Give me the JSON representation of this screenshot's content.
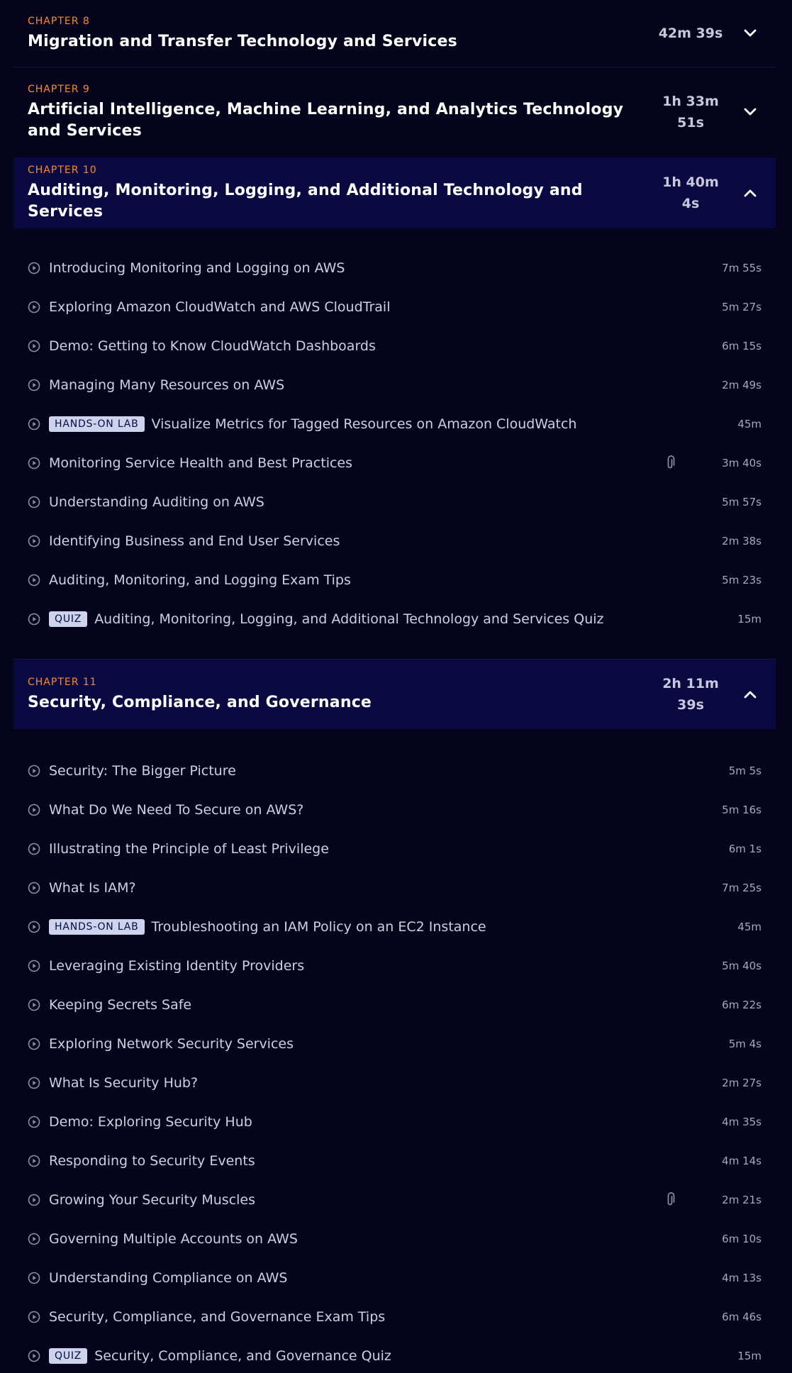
{
  "chapters": [
    {
      "label": "CHAPTER 8",
      "title": "Migration and Transfer Technology and Services",
      "duration": "42m 39s",
      "state": "collapsed",
      "toggle_icon": "chevron-down-icon"
    },
    {
      "label": "CHAPTER 9",
      "title": "Artificial Intelligence, Machine Learning, and Analytics Technology and Services",
      "duration": "1h 33m 51s",
      "state": "collapsed",
      "toggle_icon": "chevron-down-icon"
    },
    {
      "label": "CHAPTER 10",
      "title": "Auditing, Monitoring, Logging, and Additional Technology and Services",
      "duration": "1h 40m 4s",
      "state": "expanded",
      "toggle_icon": "chevron-up-icon",
      "lessons": [
        {
          "title": "Introducing Monitoring and Logging on AWS",
          "time": "7m 55s"
        },
        {
          "title": "Exploring Amazon CloudWatch and AWS CloudTrail",
          "time": "5m 27s"
        },
        {
          "title": "Demo: Getting to Know CloudWatch Dashboards",
          "time": "6m 15s"
        },
        {
          "title": "Managing Many Resources on AWS",
          "time": "2m 49s"
        },
        {
          "title": "Visualize Metrics for Tagged Resources on Amazon CloudWatch",
          "time": "45m",
          "badge": "HANDS-ON LAB"
        },
        {
          "title": "Monitoring Service Health and Best Practices",
          "time": "3m 40s",
          "attachment": true
        },
        {
          "title": "Understanding Auditing on AWS",
          "time": "5m 57s"
        },
        {
          "title": "Identifying Business and End User Services",
          "time": "2m 38s"
        },
        {
          "title": "Auditing, Monitoring, and Logging Exam Tips",
          "time": "5m 23s"
        },
        {
          "title": "Auditing, Monitoring, Logging, and Additional Technology and Services Quiz",
          "time": "15m",
          "badge": "QUIZ"
        }
      ]
    },
    {
      "label": "CHAPTER 11",
      "title": "Security, Compliance, and Governance",
      "duration": "2h 11m 39s",
      "state": "expanded",
      "toggle_icon": "chevron-up-icon",
      "lessons": [
        {
          "title": "Security: The Bigger Picture",
          "time": "5m 5s"
        },
        {
          "title": "What Do We Need To Secure on AWS?",
          "time": "5m 16s"
        },
        {
          "title": "Illustrating the Principle of Least Privilege",
          "time": "6m 1s"
        },
        {
          "title": "What Is IAM?",
          "time": "7m 25s"
        },
        {
          "title": "Troubleshooting an IAM Policy on an EC2 Instance",
          "time": "45m",
          "badge": "HANDS-ON LAB"
        },
        {
          "title": "Leveraging Existing Identity Providers",
          "time": "5m 40s"
        },
        {
          "title": "Keeping Secrets Safe",
          "time": "6m 22s"
        },
        {
          "title": "Exploring Network Security Services",
          "time": "5m 4s"
        },
        {
          "title": "What Is Security Hub?",
          "time": "2m 27s"
        },
        {
          "title": "Demo: Exploring Security Hub",
          "time": "4m 35s"
        },
        {
          "title": "Responding to Security Events",
          "time": "4m 14s"
        },
        {
          "title": "Growing Your Security Muscles",
          "time": "2m 21s",
          "attachment": true
        },
        {
          "title": "Governing Multiple Accounts on AWS",
          "time": "6m 10s"
        },
        {
          "title": "Understanding Compliance on AWS",
          "time": "4m 13s"
        },
        {
          "title": "Security, Compliance, and Governance Exam Tips",
          "time": "6m 46s"
        },
        {
          "title": "Security, Compliance, and Governance Quiz",
          "time": "15m",
          "badge": "QUIZ"
        }
      ]
    }
  ],
  "colors": {
    "background": "#06041d",
    "expanded_header": "#0b0942",
    "chapter_label": "#ff8a1f",
    "badge_bg": "#cdd3ec"
  }
}
